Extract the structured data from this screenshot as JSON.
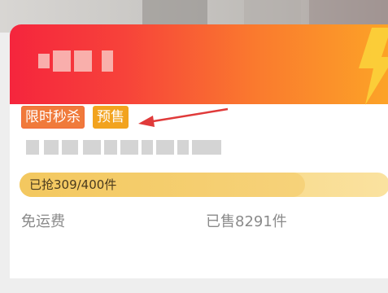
{
  "promo": {
    "tags": {
      "flash_sale": "限时秒杀",
      "presale": "预售"
    }
  },
  "progress": {
    "label": "已抢309/400件",
    "claimed": 309,
    "total": 400,
    "fraction": 0.7725
  },
  "info": {
    "shipping": "免运费",
    "sold": "已售8291件"
  },
  "colors": {
    "banner_start": "#f5253d",
    "banner_end": "#fca327",
    "tag_flash": "#f07a3b",
    "tag_presale": "#f2a31e",
    "progress_bar": "#f6d27a",
    "annotation_arrow": "#e03a3a"
  },
  "icons": {
    "banner_decoration": "lightning-bolt-icon",
    "annotation": "red-arrow-icon"
  }
}
